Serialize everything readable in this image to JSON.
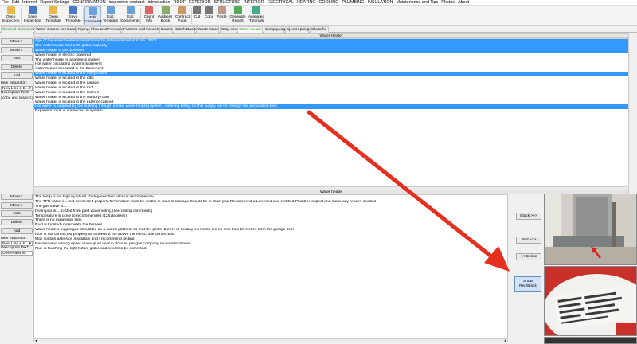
{
  "menu": [
    "File",
    "Edit",
    "Internet",
    "Report Settings",
    "CONFIRMATION",
    "inspection contract",
    "introduction",
    "ROOF",
    "EXTERIOR",
    "STRUCTURE",
    "INTERIOR",
    "ELECTRICAL",
    "HEATING",
    "COOLING",
    "PLUMBING",
    "INSULATION",
    "Maintenance and Tips",
    "Photos",
    "About"
  ],
  "toolbar": [
    {
      "label1": "Open",
      "label2": "Inspection",
      "icon": "folder-icon",
      "color": "#e8b84a"
    },
    {
      "label1": "Save",
      "label2": "Inspection",
      "icon": "save-icon",
      "color": "#4a78c8"
    },
    {
      "label1": "Open",
      "label2": "Template",
      "icon": "folder-icon",
      "color": "#e8b84a"
    },
    {
      "label1": "Save",
      "label2": "Template",
      "icon": "save-icon",
      "color": "#4a78c8"
    },
    {
      "label1": "Edit",
      "label2": "Comments",
      "icon": "document-icon",
      "color": "#6aa0d8"
    },
    {
      "label1": "Edit",
      "label2": "Template",
      "icon": "document-icon",
      "color": "#6aa0d8"
    },
    {
      "label1": "Edit",
      "label2": "Documents",
      "icon": "document-icon",
      "color": "#6aa0d8"
    },
    {
      "label1": "Client",
      "label2": "Info",
      "icon": "user-icon",
      "color": "#d66"
    },
    {
      "label1": "Address",
      "label2": "Book",
      "icon": "book-icon",
      "color": "#8a6"
    },
    {
      "label1": "Contract",
      "label2": "Page",
      "icon": "contract-icon",
      "color": "#c96"
    },
    {
      "label1": "Cut",
      "label2": "",
      "icon": "scissors-icon",
      "color": "#777"
    },
    {
      "label1": "Copy",
      "label2": "",
      "icon": "copy-icon",
      "color": "#777"
    },
    {
      "label1": "Paste",
      "label2": "",
      "icon": "paste-icon",
      "color": "#b98"
    },
    {
      "label1": "Generate",
      "label2": "Report",
      "icon": "report-icon",
      "color": "#5a5"
    },
    {
      "label1": "Animated",
      "label2": "Tutorials",
      "icon": "tutorial-icon",
      "color": "#4a8"
    }
  ],
  "tabs": [
    "General Comments",
    "Water Source to House",
    "Piping",
    "Flow and Pressure",
    "Fixtures and Faucets",
    "Drains",
    "Catch Basin",
    "Waste stack",
    "Stop sink",
    "Water Heater",
    "Sump pump",
    "Ejector pump",
    "Shutoffs"
  ],
  "top_panel": {
    "title": "Water Heater",
    "buttons": [
      "Move ↑",
      "Move ↓",
      "Sort",
      "Delete",
      "Add"
    ],
    "item_separator_label": "Item Separator:",
    "item_separator_value": "New Line & B...",
    "description_label": "Description Text:",
    "description_value": "cribe and Inspect :",
    "rows": [
      {
        "text": "Age of the water heater is determined by plate information to be...2001",
        "selected": true
      },
      {
        "text": "The water heater has a 40 gallon capacity",
        "selected": true
      },
      {
        "text": "Water heater is gas powered",
        "selected": true
      },
      {
        "text": "Water heater is electric powered",
        "selected": false
      },
      {
        "text": "The water heater is a tankless system",
        "selected": false
      },
      {
        "text": "Hot water circulating system is present",
        "selected": false
      },
      {
        "text": "water heater is located in the basement",
        "selected": false
      },
      {
        "text": "Water heater is located in the utility closet.",
        "selected": true
      },
      {
        "text": "Water heater is located in the attic",
        "selected": false
      },
      {
        "text": "Water heater is located in the garage",
        "selected": false
      },
      {
        "text": "Water heater is located in the roof",
        "selected": false
      },
      {
        "text": "Water heater is located in the kitchen",
        "selected": false
      },
      {
        "text": "Water heater is located in the laundry room",
        "selected": false
      },
      {
        "text": "Water heater is located in the exterior cabinet",
        "selected": false
      },
      {
        "text": "Hot water is supplied by the building through a main water heating system, meaning billing for this supply will be through the association fees",
        "selected": true
      },
      {
        "text": "Expansion tank is connected to system",
        "selected": false
      }
    ]
  },
  "bottom_panel": {
    "title": "Water heater",
    "buttons": [
      "Move ↑",
      "Move ↓",
      "Sort",
      "Delete",
      "Add"
    ],
    "item_separator_label": "Item Separator:",
    "item_separator_value": "New Line & B...",
    "description_label": "Description Text:",
    "description_value": "Observations :",
    "rows": [
      "The temp is set high by about 10 degrees from what is recommended.",
      "The TPR valve is....not connected properly.Termination must be visible in case of leakage.Should be in drain pan.Recommend a Licensed and certified Plumber inspect and make any repairs needed",
      "The gas valve is....",
      "Drain pan is.....rusted from past water sitting.(see ceiling comments)",
      "Temperature is close to recommended (125 degrees)",
      "There is no expansion tank",
      "Rust is located underneath the burners",
      "Water heaters in garages should be on a raised platform so that the pilots, burner or heating elements are no less than 18 inches from the garage floor",
      "Flue is not connected properly as it needs to be above the HVAC flue connection.",
      "May contain asbestos insulation and I recommend testing",
      "Recommend adding upper makeup air vent in door as per gas company recommendations.",
      "Flue is touching the light fixture globe and needs to be corrected."
    ]
  },
  "right_buttons": {
    "black": "Black >>>",
    "red": "Red >>>",
    "delete": "<< Delete",
    "show1": "Show",
    "show2": "Red/Black"
  },
  "colors": {
    "selection": "#3399ff",
    "arrow": "#e53020",
    "tab_green": "#1f8a1f"
  }
}
